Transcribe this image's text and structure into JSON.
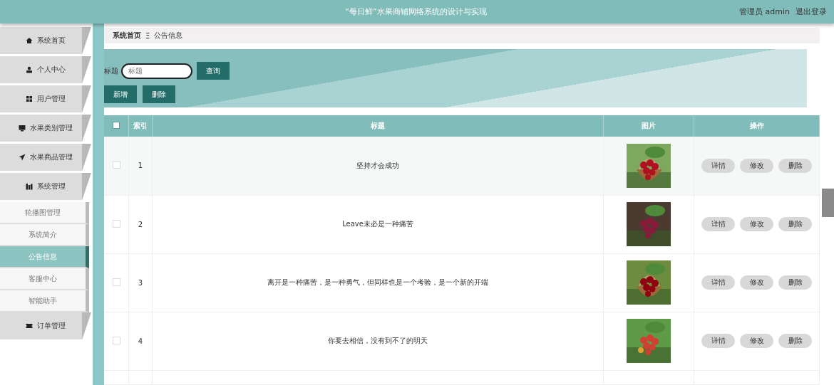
{
  "header": {
    "title": "“每日鲜”水果商铺网络系统的设计与实现",
    "user": "管理员 admin",
    "logout": "退出登录"
  },
  "sidebar": {
    "items": [
      {
        "label": "系统首页"
      },
      {
        "label": "个人中心"
      },
      {
        "label": "用户管理"
      },
      {
        "label": "水果类别管理"
      },
      {
        "label": "水果商品管理"
      },
      {
        "label": "系统管理",
        "children": [
          {
            "label": "轮播图管理",
            "selected": false
          },
          {
            "label": "系统简介",
            "selected": false
          },
          {
            "label": "公告信息",
            "selected": true
          },
          {
            "label": "客服中心",
            "selected": false
          },
          {
            "label": "智能助手",
            "selected": false
          }
        ]
      },
      {
        "label": "订单管理"
      }
    ]
  },
  "breadcrumb": [
    "系统首页",
    "Ξ",
    "公告信息"
  ],
  "search": {
    "label": "标题",
    "placeholder": "标题",
    "button": "查询"
  },
  "actions": [
    "新增",
    "删除"
  ],
  "table": {
    "all_checked": false,
    "columns": [
      "索引",
      "标题",
      "图片",
      "操作"
    ],
    "rows": [
      {
        "checked": false,
        "index": "1",
        "title": "坚持才会成功",
        "image": {
          "kind": "picture"
        },
        "buttons": [
          "详情",
          "修改",
          "删除"
        ]
      },
      {
        "checked": false,
        "index": "2",
        "title": "Leave未必是一种痛苦",
        "image": {
          "kind": "picture"
        },
        "buttons": [
          "详情",
          "修改",
          "删除"
        ]
      },
      {
        "checked": false,
        "index": "3",
        "title": "离开是一种痛苦，是一种勇气，但同样也是一个考验，是一个新的开端",
        "image": {
          "kind": "picture"
        },
        "buttons": [
          "详情",
          "修改",
          "删除"
        ]
      },
      {
        "checked": false,
        "index": "4",
        "title": "你要去相信，没有到不了的明天",
        "image": {
          "kind": "picture"
        },
        "buttons": [
          "详情",
          "修改",
          "删除"
        ]
      }
    ]
  }
}
